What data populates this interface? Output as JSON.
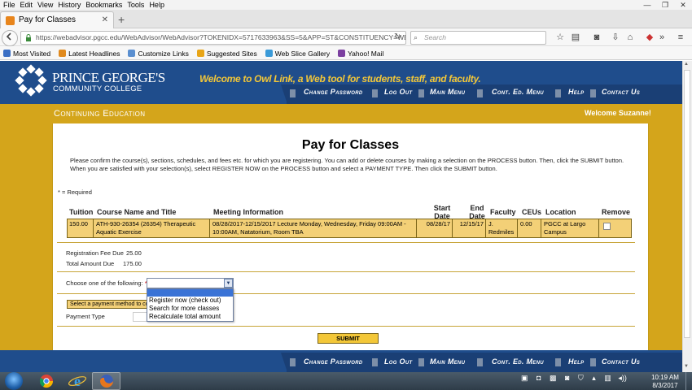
{
  "browser": {
    "menu": [
      "File",
      "Edit",
      "View",
      "History",
      "Bookmarks",
      "Tools",
      "Help"
    ],
    "window_controls": [
      "—",
      "❐",
      "✕"
    ],
    "tab_title": "Pay for Classes",
    "tab_close": "✕",
    "new_tab": "+",
    "url": "https://webadvisor.pgcc.edu/WebAdvisor/WebAdvisor?TOKENIDX=5717633963&SS=5&APP=ST&CONSTITUENCY=WBCE",
    "search_placeholder": "Search",
    "bookmarks": [
      "Most Visited",
      "Latest Headlines",
      "Customize Links",
      "Suggested Sites",
      "Web Slice Gallery",
      "Yahoo! Mail"
    ],
    "bookmark_colors": [
      "#3b6fc4",
      "#e08a1e",
      "#5a8fd0",
      "#e8a517",
      "#3a9ad8",
      "#7b3fa0"
    ],
    "toolbar_icons": [
      "star-icon",
      "reader-icon",
      "pocket-icon",
      "download-icon",
      "home-icon",
      "addon-icon",
      "overflow-icon",
      "menu-icon"
    ]
  },
  "site": {
    "logo_line1": "PRINCE GEORGE'S",
    "logo_line2": "COMMUNITY COLLEGE",
    "welcome_prefix": "Welcome to ",
    "welcome_brand": "Owl Link",
    "welcome_suffix": ", a Web tool for students, staff, and faculty.",
    "nav": [
      "Change Password",
      "Log Out",
      "Main Menu",
      "Cont. Ed. Menu",
      "Help",
      "Contact Us"
    ],
    "section_title": "Continuing Education",
    "welcome_user": "Welcome Suzanne!",
    "accent_blue": "#1f4d8c",
    "accent_gold": "#d4a51b"
  },
  "page": {
    "title": "Pay for Classes",
    "instructions": "Please confirm the course(s), sections, schedules, and fees etc. for which you are registering. You can add or delete courses by making a selection on the PROCESS button. Then, click the SUBMIT button. When you are satisfied with your selection(s), select REGISTER NOW on the PROCESS button and select a PAYMENT TYPE. Then click the SUBMIT button.",
    "required_note": "* = Required",
    "table": {
      "headers": {
        "tuition": "Tuition",
        "course": "Course Name and Title",
        "meeting": "Meeting Information",
        "start": "Start Date",
        "end": "End Date",
        "faculty": "Faculty",
        "ceus": "CEUs",
        "location": "Location",
        "remove": "Remove"
      },
      "row": {
        "tuition": "150.00",
        "course": "ATH-930-26354 (26354) Therapeutic Aquatic Exercise",
        "meeting": "08/28/2017-12/15/2017 Lecture Monday, Wednesday, Friday 09:00AM - 10:00AM, Natatorium, Room TBA",
        "start": "08/28/17",
        "end": "12/15/17",
        "faculty": "J. Redmiles",
        "ceus": "0.00",
        "location": "PGCC at Largo Campus"
      }
    },
    "reg_fee_label": "Registration Fee Due",
    "reg_fee_value": "25.00",
    "total_label": "Total Amount Due",
    "total_value": "175.00",
    "choose_label": "Choose one of the following:",
    "choose_required": "*",
    "dropdown_options": [
      "Register now (check out)",
      "Search for more classes",
      "Recalculate total amount"
    ],
    "payment_method_label": "Select a payment method to cont",
    "payment_type_label": "Payment Type",
    "submit_label": "SUBMIT"
  },
  "taskbar": {
    "time": "10:19 AM",
    "date": "8/3/2017"
  }
}
